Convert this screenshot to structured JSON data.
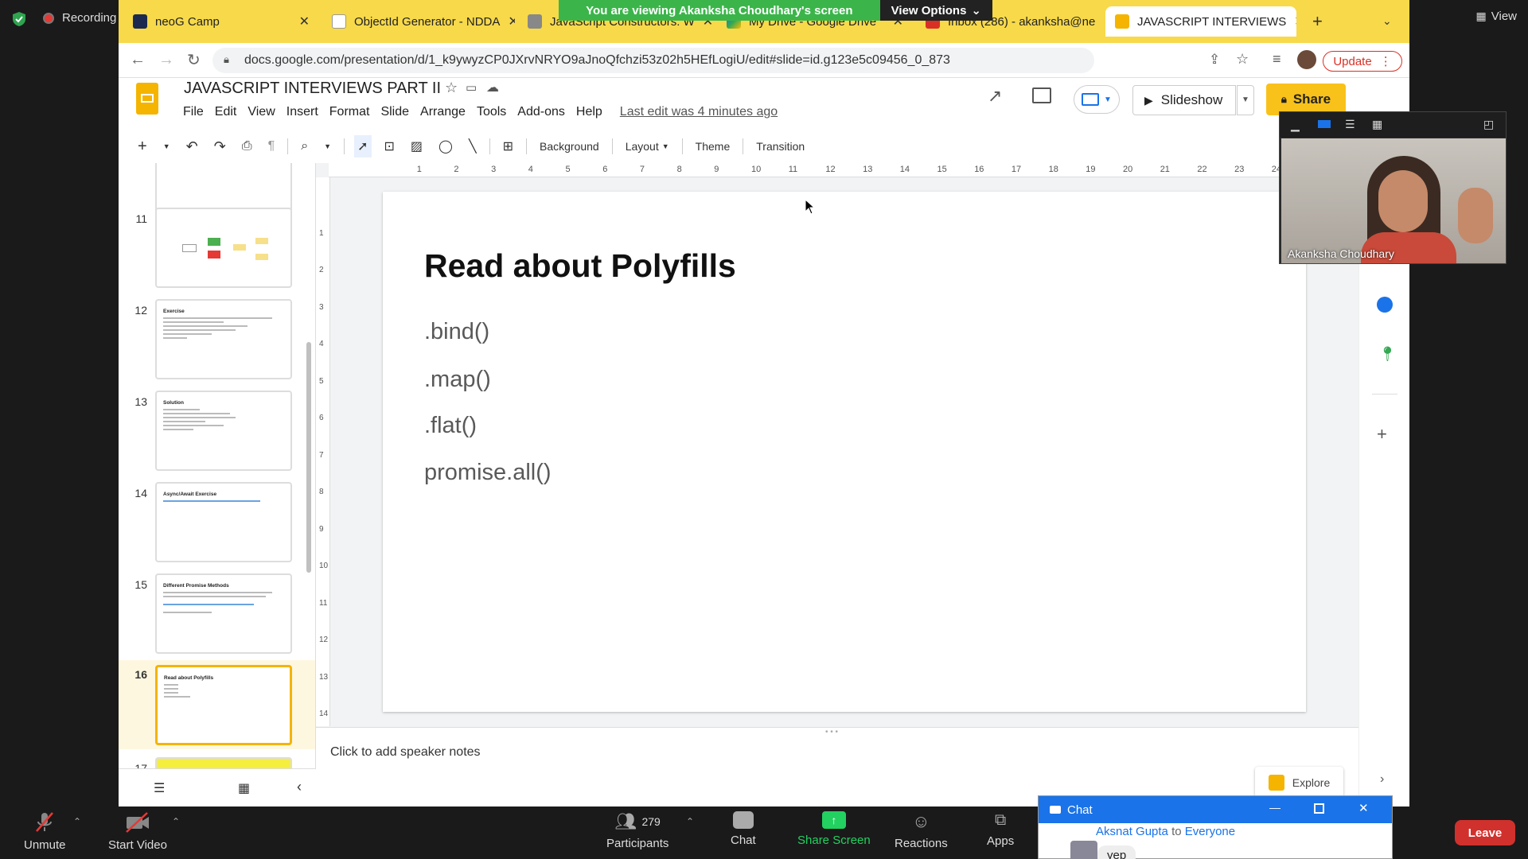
{
  "zoom": {
    "recording_label": "Recording",
    "view_label": "View",
    "viewing_banner": "You are viewing Akanksha Choudhary's screen",
    "view_options_label": "View Options",
    "bottom": {
      "unmute": "Unmute",
      "start_video": "Start Video",
      "participants": "Participants",
      "participants_count": "279",
      "chat": "Chat",
      "share_screen": "Share Screen",
      "reactions": "Reactions",
      "apps": "Apps",
      "leave": "Leave"
    },
    "video": {
      "name": "Akanksha Choudhary"
    },
    "chat_window": {
      "title": "Chat",
      "sender": "Aksnat Gupta",
      "recipient_prefix": "to",
      "recipient": "Everyone",
      "message": "yep"
    }
  },
  "browser": {
    "tabs": [
      {
        "label": "neoG Camp",
        "color": "#1b2a4e"
      },
      {
        "label": "ObjectId Generator - NDDA",
        "color": "#8b0000"
      },
      {
        "label": "JavaScript Constructors: W",
        "color": "#555555"
      },
      {
        "label": "My Drive - Google Drive",
        "color": "#1a73e8"
      },
      {
        "label": "Inbox (286) - akanksha@ne",
        "color": "#d93025"
      },
      {
        "label": "JAVASCRIPT INTERVIEWS",
        "color": "#f4b400"
      }
    ],
    "url": "docs.google.com/presentation/d/1_k9ywyzCP0JXrvNRYO9aJnoQfchzi53z02h5HEfLogiU/edit#slide=id.g123e5c09456_0_873",
    "update_label": "Update"
  },
  "slides_app": {
    "title": "JAVASCRIPT  INTERVIEWS PART II",
    "menu": [
      "File",
      "Edit",
      "View",
      "Insert",
      "Format",
      "Slide",
      "Arrange",
      "Tools",
      "Add-ons",
      "Help"
    ],
    "last_edit": "Last edit was 4 minutes ago",
    "slideshow_label": "Slideshow",
    "share_label": "Share",
    "toolbar": {
      "background": "Background",
      "layout": "Layout",
      "theme": "Theme",
      "transition": "Transition"
    },
    "ruler_h_ticks": [
      "1",
      "2",
      "3",
      "4",
      "5",
      "6",
      "7",
      "8",
      "9",
      "10",
      "11",
      "12",
      "13",
      "14",
      "15",
      "16",
      "17",
      "18",
      "19",
      "20",
      "21",
      "22",
      "23",
      "24"
    ],
    "ruler_v_ticks": [
      "1",
      "2",
      "3",
      "4",
      "5",
      "6",
      "7",
      "8",
      "9",
      "10",
      "11",
      "12",
      "13",
      "14"
    ],
    "thumbnails": [
      {
        "num": "11",
        "title": ""
      },
      {
        "num": "12",
        "title": "Exercise"
      },
      {
        "num": "13",
        "title": "Solution"
      },
      {
        "num": "14",
        "title": "Async/Await Exercise"
      },
      {
        "num": "15",
        "title": "Different Promise Methods"
      },
      {
        "num": "16",
        "title": "Read about Polyfills"
      },
      {
        "num": "17",
        "title": ""
      }
    ],
    "slide": {
      "title": "Read about Polyfills",
      "items": [
        ".bind()",
        ".map()",
        ".flat()",
        "promise.all()"
      ]
    },
    "speaker_notes_placeholder": "Click to add speaker notes",
    "explore_label": "Explore"
  }
}
